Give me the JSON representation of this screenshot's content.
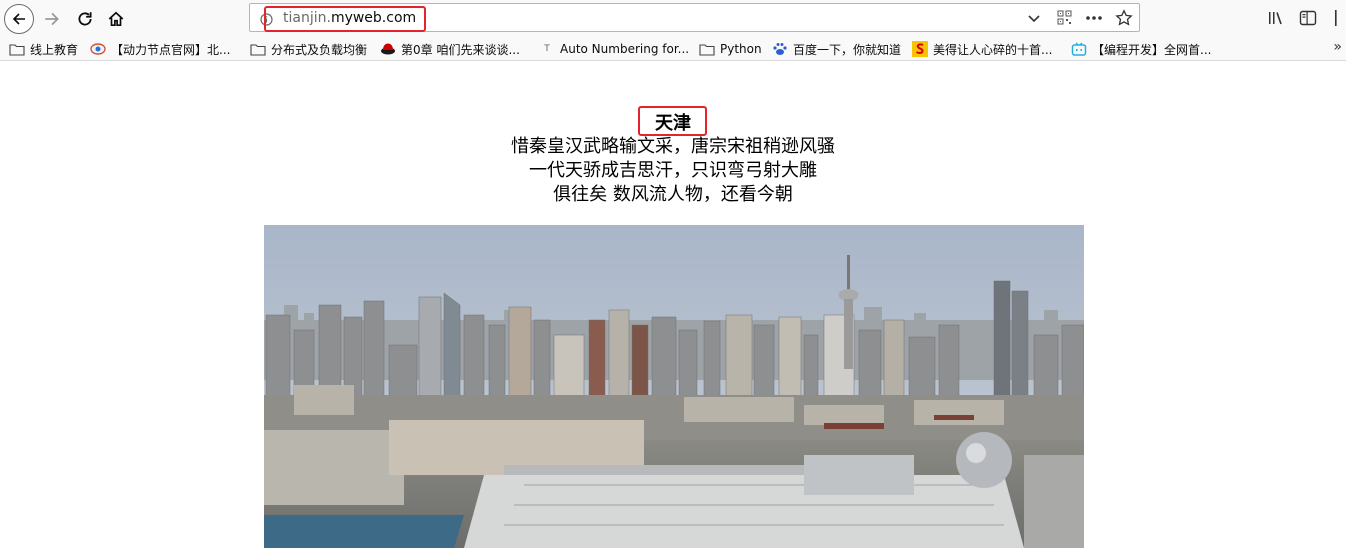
{
  "toolbar": {
    "url_prefix": "tianjin.",
    "url_host": "myweb.com"
  },
  "bookmarks": [
    {
      "label": "线上教育",
      "icon": "folder-icon"
    },
    {
      "label": "【动力节点官网】北...",
      "icon": "site-favicon"
    },
    {
      "label": "分布式及负载均衡",
      "icon": "folder-icon"
    },
    {
      "label": "第0章 咱们先来谈谈...",
      "icon": "redhat-icon"
    },
    {
      "label": "Auto Numbering for...",
      "icon": "text-favicon"
    },
    {
      "label": "Python",
      "icon": "folder-icon"
    },
    {
      "label": "百度一下，你就知道",
      "icon": "baidu-icon"
    },
    {
      "label": "美得让人心碎的十首...",
      "icon": "sohu-icon"
    },
    {
      "label": "【编程开发】全网首...",
      "icon": "bilibili-icon"
    }
  ],
  "page": {
    "title": "天津",
    "poem": [
      "惜秦皇汉武略输文采，唐宗宋祖稍逊风骚",
      "一代天骄成吉思汗，只识弯弓射大雕",
      "俱往矣 数风流人物，还看今朝"
    ]
  },
  "colors": {
    "highlight": "#e5232b",
    "toolbar_bg": "#f9f9fa"
  }
}
